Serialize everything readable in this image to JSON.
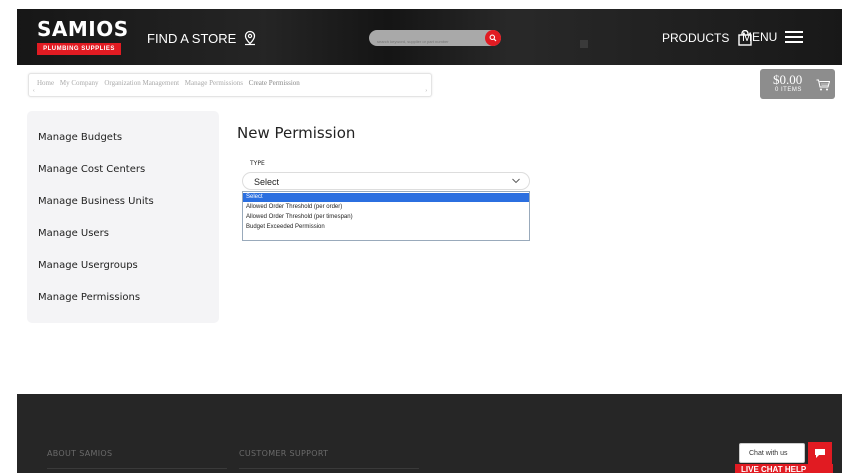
{
  "header": {
    "logo_text": "SAMIOS",
    "logo_subtitle": "PLUMBING SUPPLIES",
    "find_store_label": "FIND A STORE",
    "search_placeholder": "search keyword, supplier or part number",
    "products_label": "PRODUCTS",
    "menu_label": "MENU"
  },
  "breadcrumb": {
    "items": [
      "Home",
      "My Company",
      "Organization Management",
      "Manage Permissions",
      "Create Permission"
    ]
  },
  "cart": {
    "amount": "$0.00",
    "items_label": "0 ITEMS"
  },
  "sidebar": {
    "items": [
      "Manage Budgets",
      "Manage Cost Centers",
      "Manage Business Units",
      "Manage Users",
      "Manage Usergroups",
      "Manage Permissions"
    ]
  },
  "main": {
    "title": "New Permission",
    "type_label": "TYPE",
    "select_value": "Select",
    "options": [
      "Select",
      "Allowed Order Threshold (per order)",
      "Allowed Order Threshold (per timespan)",
      "Budget Exceeded Permission"
    ],
    "selected_index": 0
  },
  "footer": {
    "col1": "ABOUT SAMIOS",
    "col2": "CUSTOMER SUPPORT"
  },
  "chat": {
    "bubble_text": "Chat with us",
    "live_label": "LIVE CHAT HELP"
  },
  "colors": {
    "brand_red": "#e11b22",
    "header_bg": "#1b1b1b",
    "option_highlight": "#2b6fe0",
    "footer_bg": "#262626"
  }
}
